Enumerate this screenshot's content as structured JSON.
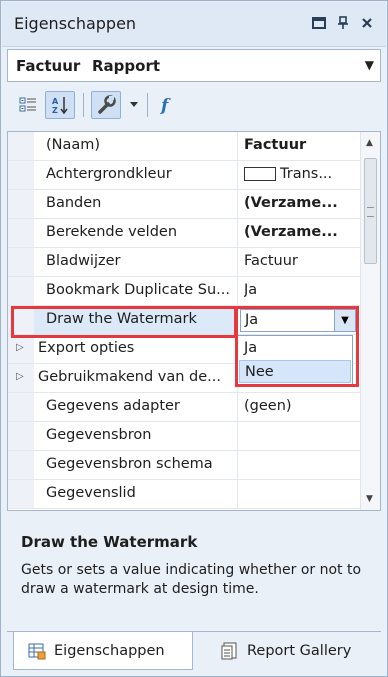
{
  "window": {
    "title": "Eigenschappen"
  },
  "object_selector": {
    "name": "Factuur",
    "type": "Rapport"
  },
  "toolbar": {
    "buttons": [
      "categorized-icon",
      "alphabetical-icon",
      "properties-icon",
      "dropdown-arrow-icon",
      "events-icon"
    ]
  },
  "properties": [
    {
      "name": "(Naam)",
      "value": "Factuur",
      "bold": true
    },
    {
      "name": "Achtergrondkleur",
      "value": "Trans...",
      "swatch": true
    },
    {
      "name": "Banden",
      "value": "(Verzame...",
      "bold": true
    },
    {
      "name": "Berekende velden",
      "value": "(Verzame...",
      "bold": true
    },
    {
      "name": "Bladwijzer",
      "value": "Factuur"
    },
    {
      "name": "Bookmark Duplicate Su...",
      "value": "Ja"
    },
    {
      "name": "Draw the Watermark",
      "value": "Ja",
      "selected": true
    },
    {
      "name": "Export opties",
      "value": "",
      "expandable": true
    },
    {
      "name": "Gebruikmakend van de...",
      "value": "",
      "expandable": true
    },
    {
      "name": "Gegevens adapter",
      "value": "(geen)"
    },
    {
      "name": "Gegevensbron",
      "value": ""
    },
    {
      "name": "Gegevensbron schema",
      "value": ""
    },
    {
      "name": "Gegevenslid",
      "value": ""
    }
  ],
  "dropdown": {
    "options": [
      "Ja",
      "Nee"
    ],
    "hovered": "Nee"
  },
  "description": {
    "title": "Draw the Watermark",
    "text": "Gets or sets a value indicating whether or not to draw a watermark at design time."
  },
  "tabs": [
    {
      "label": "Eigenschappen",
      "active": true
    },
    {
      "label": "Report Gallery",
      "active": false
    }
  ],
  "colors": {
    "highlight": "#e5393f",
    "panel_bg": "#eaf0f8",
    "accent": "#2a6ebb"
  }
}
